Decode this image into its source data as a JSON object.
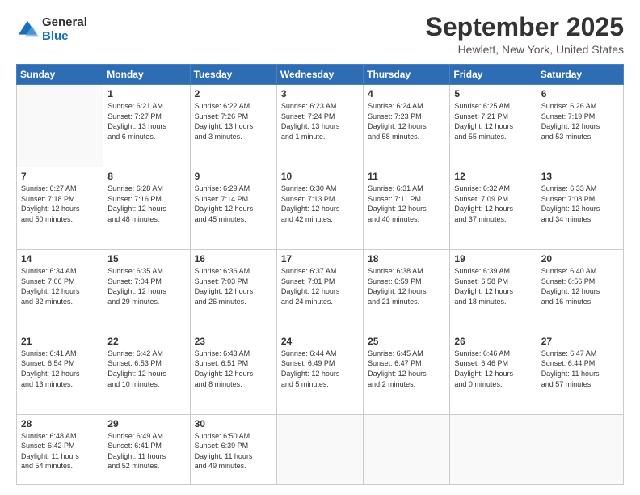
{
  "logo": {
    "general": "General",
    "blue": "Blue"
  },
  "header": {
    "title": "September 2025",
    "subtitle": "Hewlett, New York, United States"
  },
  "days_of_week": [
    "Sunday",
    "Monday",
    "Tuesday",
    "Wednesday",
    "Thursday",
    "Friday",
    "Saturday"
  ],
  "weeks": [
    [
      {
        "day": "",
        "info": ""
      },
      {
        "day": "1",
        "info": "Sunrise: 6:21 AM\nSunset: 7:27 PM\nDaylight: 13 hours\nand 6 minutes."
      },
      {
        "day": "2",
        "info": "Sunrise: 6:22 AM\nSunset: 7:26 PM\nDaylight: 13 hours\nand 3 minutes."
      },
      {
        "day": "3",
        "info": "Sunrise: 6:23 AM\nSunset: 7:24 PM\nDaylight: 13 hours\nand 1 minute."
      },
      {
        "day": "4",
        "info": "Sunrise: 6:24 AM\nSunset: 7:23 PM\nDaylight: 12 hours\nand 58 minutes."
      },
      {
        "day": "5",
        "info": "Sunrise: 6:25 AM\nSunset: 7:21 PM\nDaylight: 12 hours\nand 55 minutes."
      },
      {
        "day": "6",
        "info": "Sunrise: 6:26 AM\nSunset: 7:19 PM\nDaylight: 12 hours\nand 53 minutes."
      }
    ],
    [
      {
        "day": "7",
        "info": "Sunrise: 6:27 AM\nSunset: 7:18 PM\nDaylight: 12 hours\nand 50 minutes."
      },
      {
        "day": "8",
        "info": "Sunrise: 6:28 AM\nSunset: 7:16 PM\nDaylight: 12 hours\nand 48 minutes."
      },
      {
        "day": "9",
        "info": "Sunrise: 6:29 AM\nSunset: 7:14 PM\nDaylight: 12 hours\nand 45 minutes."
      },
      {
        "day": "10",
        "info": "Sunrise: 6:30 AM\nSunset: 7:13 PM\nDaylight: 12 hours\nand 42 minutes."
      },
      {
        "day": "11",
        "info": "Sunrise: 6:31 AM\nSunset: 7:11 PM\nDaylight: 12 hours\nand 40 minutes."
      },
      {
        "day": "12",
        "info": "Sunrise: 6:32 AM\nSunset: 7:09 PM\nDaylight: 12 hours\nand 37 minutes."
      },
      {
        "day": "13",
        "info": "Sunrise: 6:33 AM\nSunset: 7:08 PM\nDaylight: 12 hours\nand 34 minutes."
      }
    ],
    [
      {
        "day": "14",
        "info": "Sunrise: 6:34 AM\nSunset: 7:06 PM\nDaylight: 12 hours\nand 32 minutes."
      },
      {
        "day": "15",
        "info": "Sunrise: 6:35 AM\nSunset: 7:04 PM\nDaylight: 12 hours\nand 29 minutes."
      },
      {
        "day": "16",
        "info": "Sunrise: 6:36 AM\nSunset: 7:03 PM\nDaylight: 12 hours\nand 26 minutes."
      },
      {
        "day": "17",
        "info": "Sunrise: 6:37 AM\nSunset: 7:01 PM\nDaylight: 12 hours\nand 24 minutes."
      },
      {
        "day": "18",
        "info": "Sunrise: 6:38 AM\nSunset: 6:59 PM\nDaylight: 12 hours\nand 21 minutes."
      },
      {
        "day": "19",
        "info": "Sunrise: 6:39 AM\nSunset: 6:58 PM\nDaylight: 12 hours\nand 18 minutes."
      },
      {
        "day": "20",
        "info": "Sunrise: 6:40 AM\nSunset: 6:56 PM\nDaylight: 12 hours\nand 16 minutes."
      }
    ],
    [
      {
        "day": "21",
        "info": "Sunrise: 6:41 AM\nSunset: 6:54 PM\nDaylight: 12 hours\nand 13 minutes."
      },
      {
        "day": "22",
        "info": "Sunrise: 6:42 AM\nSunset: 6:53 PM\nDaylight: 12 hours\nand 10 minutes."
      },
      {
        "day": "23",
        "info": "Sunrise: 6:43 AM\nSunset: 6:51 PM\nDaylight: 12 hours\nand 8 minutes."
      },
      {
        "day": "24",
        "info": "Sunrise: 6:44 AM\nSunset: 6:49 PM\nDaylight: 12 hours\nand 5 minutes."
      },
      {
        "day": "25",
        "info": "Sunrise: 6:45 AM\nSunset: 6:47 PM\nDaylight: 12 hours\nand 2 minutes."
      },
      {
        "day": "26",
        "info": "Sunrise: 6:46 AM\nSunset: 6:46 PM\nDaylight: 12 hours\nand 0 minutes."
      },
      {
        "day": "27",
        "info": "Sunrise: 6:47 AM\nSunset: 6:44 PM\nDaylight: 11 hours\nand 57 minutes."
      }
    ],
    [
      {
        "day": "28",
        "info": "Sunrise: 6:48 AM\nSunset: 6:42 PM\nDaylight: 11 hours\nand 54 minutes."
      },
      {
        "day": "29",
        "info": "Sunrise: 6:49 AM\nSunset: 6:41 PM\nDaylight: 11 hours\nand 52 minutes."
      },
      {
        "day": "30",
        "info": "Sunrise: 6:50 AM\nSunset: 6:39 PM\nDaylight: 11 hours\nand 49 minutes."
      },
      {
        "day": "",
        "info": ""
      },
      {
        "day": "",
        "info": ""
      },
      {
        "day": "",
        "info": ""
      },
      {
        "day": "",
        "info": ""
      }
    ]
  ]
}
